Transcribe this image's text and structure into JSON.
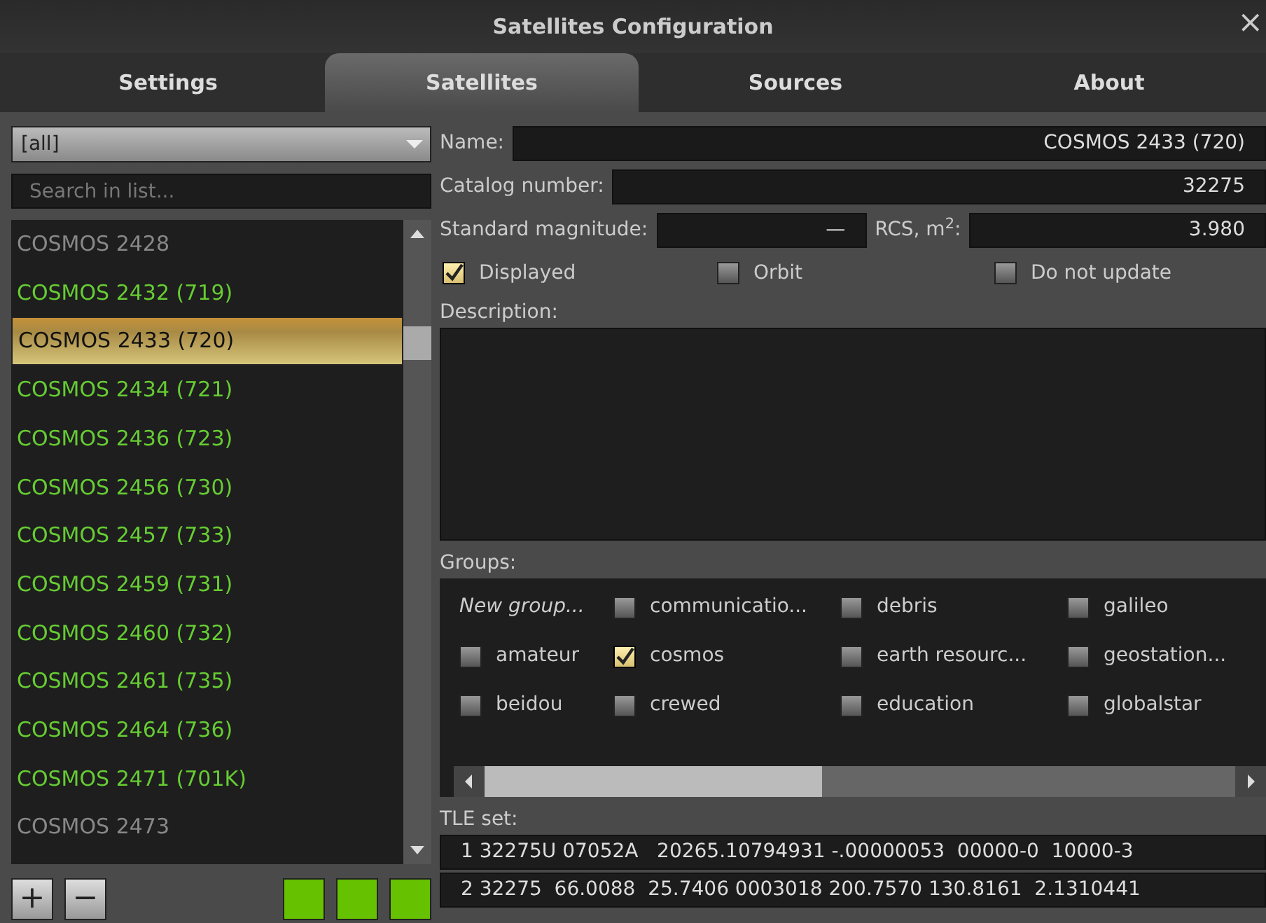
{
  "window": {
    "title": "Satellites Configuration",
    "close": "×"
  },
  "tabs": [
    {
      "label": "Settings",
      "selected": false
    },
    {
      "label": "Satellites",
      "selected": true
    },
    {
      "label": "Sources",
      "selected": false
    },
    {
      "label": "About",
      "selected": false
    }
  ],
  "filter": {
    "value": "[all]"
  },
  "search": {
    "placeholder": "Search in list..."
  },
  "satellites": [
    {
      "name": "COSMOS 2428",
      "displayed": false,
      "selected": false
    },
    {
      "name": "COSMOS 2432 (719)",
      "displayed": true,
      "selected": false
    },
    {
      "name": "COSMOS 2433 (720)",
      "displayed": true,
      "selected": true
    },
    {
      "name": "COSMOS 2434 (721)",
      "displayed": true,
      "selected": false
    },
    {
      "name": "COSMOS 2436 (723)",
      "displayed": true,
      "selected": false
    },
    {
      "name": "COSMOS 2456 (730)",
      "displayed": true,
      "selected": false
    },
    {
      "name": "COSMOS 2457 (733)",
      "displayed": true,
      "selected": false
    },
    {
      "name": "COSMOS 2459 (731)",
      "displayed": true,
      "selected": false
    },
    {
      "name": "COSMOS 2460 (732)",
      "displayed": true,
      "selected": false
    },
    {
      "name": "COSMOS 2461 (735)",
      "displayed": true,
      "selected": false
    },
    {
      "name": "COSMOS 2464 (736)",
      "displayed": true,
      "selected": false
    },
    {
      "name": "COSMOS 2471 (701K)",
      "displayed": true,
      "selected": false
    },
    {
      "name": "COSMOS 2473",
      "displayed": false,
      "selected": false
    }
  ],
  "list_buttons": [
    "+",
    "−"
  ],
  "fields": {
    "name_label": "Name:",
    "name": "COSMOS 2433 (720)",
    "catalog_label": "Catalog number:",
    "catalog": "32275",
    "magnitude_label": "Standard magnitude:",
    "magnitude": "—",
    "rcs_label": "RCS, m$^{2}$:",
    "rcs": "3.980"
  },
  "options": [
    {
      "label": "Displayed",
      "checked": true
    },
    {
      "label": "Orbit",
      "checked": false
    },
    {
      "label": "Do not update",
      "checked": false
    }
  ],
  "description_label": "Description:",
  "groups_label": "Groups:",
  "groups": [
    {
      "kind": "new",
      "label": "New group..."
    },
    {
      "kind": "checkbox",
      "label": "communicatio...",
      "checked": false
    },
    {
      "kind": "checkbox",
      "label": "debris",
      "checked": false
    },
    {
      "kind": "checkbox",
      "label": "galileo",
      "checked": false
    },
    {
      "kind": "checkbox",
      "label": "amateur",
      "checked": false
    },
    {
      "kind": "checkbox",
      "label": "cosmos",
      "checked": true
    },
    {
      "kind": "checkbox",
      "label": "earth resourc...",
      "checked": false
    },
    {
      "kind": "checkbox",
      "label": "geostation...",
      "checked": false
    },
    {
      "kind": "checkbox",
      "label": "beidou",
      "checked": false
    },
    {
      "kind": "checkbox",
      "label": "crewed",
      "checked": false
    },
    {
      "kind": "checkbox",
      "label": "education",
      "checked": false
    },
    {
      "kind": "checkbox",
      "label": "globalstar",
      "checked": false
    }
  ],
  "tle_label": "TLE set:",
  "tle": [
    "1 32275U 07052A   20265.10794931 -.00000053  00000-0  10000-3",
    "2 32275  66.0088  25.7406 0003018 200.7570 130.8161  2.1310441"
  ]
}
